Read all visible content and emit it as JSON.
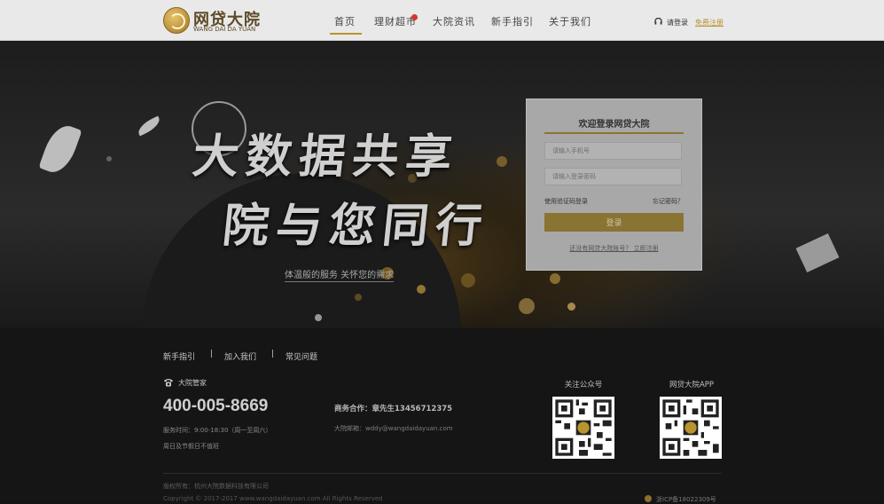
{
  "header": {
    "logo_cn": "网贷大院",
    "logo_en": "WANG DAI DA YUAN",
    "nav": [
      "首页",
      "理财超市",
      "大院资讯",
      "新手指引",
      "关于我们"
    ],
    "active_nav": "首页",
    "login_label": "请登录",
    "register_label": "免费注册"
  },
  "banner": {
    "headline_line1": "大数据共享",
    "headline_line2": "院与您同行",
    "slogan": "体温般的服务 关怀您的需求"
  },
  "login": {
    "title": "欢迎登录网贷大院",
    "phone_placeholder": "请输入手机号",
    "password_placeholder": "请输入登录密码",
    "sms_login": "使用验证码登录",
    "forgot": "忘记密码？",
    "button": "登录",
    "register_prompt": "还没有网贷大院账号？ 立即注册"
  },
  "footer": {
    "links": [
      "新手指引",
      "加入我们",
      "常见问题"
    ],
    "separator": "|",
    "steward_label": "大院管家",
    "phone": "400-005-8669",
    "hours": "服务时间：9:00-18:30（周一至周六）",
    "holiday_note": "周日及节假日不值班",
    "business": "商务合作：章先生13456712375",
    "email": "大院邮箱：wddy@wangdaidayuan.com",
    "qr_wechat_title": "关注公众号",
    "qr_app_title": "网贷大院APP",
    "copyright": "版权所有：杭州大院数据科技有限公司",
    "copyright2": "Copyright © 2017-2017 www.wangdaidayuan.com  All Rights Reserved",
    "icp": "浙ICP备18022309号"
  },
  "colors": {
    "accent_gold": "#b9932f",
    "header_bg": "#e9e9e9",
    "footer_bg": "#151515"
  }
}
